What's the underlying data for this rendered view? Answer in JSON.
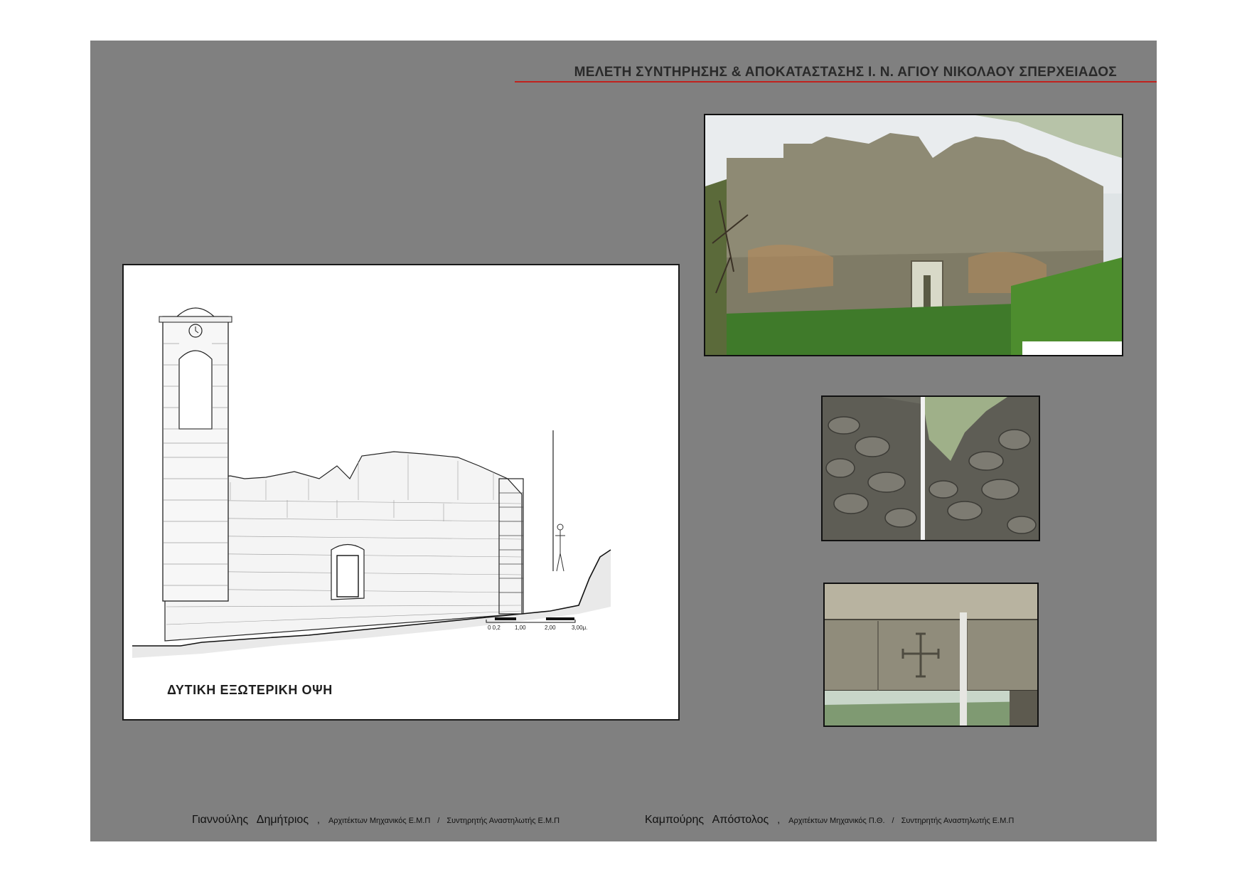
{
  "header": {
    "title": "ΜΕΛΕΤΗ ΣΥΝΤΗΡΗΣΗΣ & ΑΠΟΚΑΤΑΣΤΑΣΗΣ Ι. Ν. ΑΓΙΟΥ ΝΙΚΟΛΑΟΥ ΣΠΕΡΧΕΙΑΔΟΣ",
    "accent_color": "#c0221d"
  },
  "drawing": {
    "caption": "ΔΥΤΙΚΗ  ΕΞΩΤΕΡΙΚΗ ΟΨΗ",
    "scale_labels": [
      "0 0,2",
      "1,00",
      "2,00",
      "3,00μ."
    ]
  },
  "photos": [
    {
      "subject": "west facade of ruined church"
    },
    {
      "subject": "damaged wall top with measuring rod"
    },
    {
      "subject": "lintel with carved cross"
    }
  ],
  "footer": {
    "author1": {
      "name": "Γιαννούλης Δημήτριος",
      "role1": "Αρχιτέκτων Μηχανικός Ε.Μ.Π",
      "role2": "Συντηρητής Αναστηλωτής Ε.Μ.Π"
    },
    "author2": {
      "name": "Καμπούρης Απόστολος",
      "role1": "Αρχιτέκτων Μηχανικός Π.Θ.",
      "role2": "Συντηρητής Αναστηλωτής Ε.Μ.Π"
    },
    "comma": ",",
    "slash": "/"
  }
}
